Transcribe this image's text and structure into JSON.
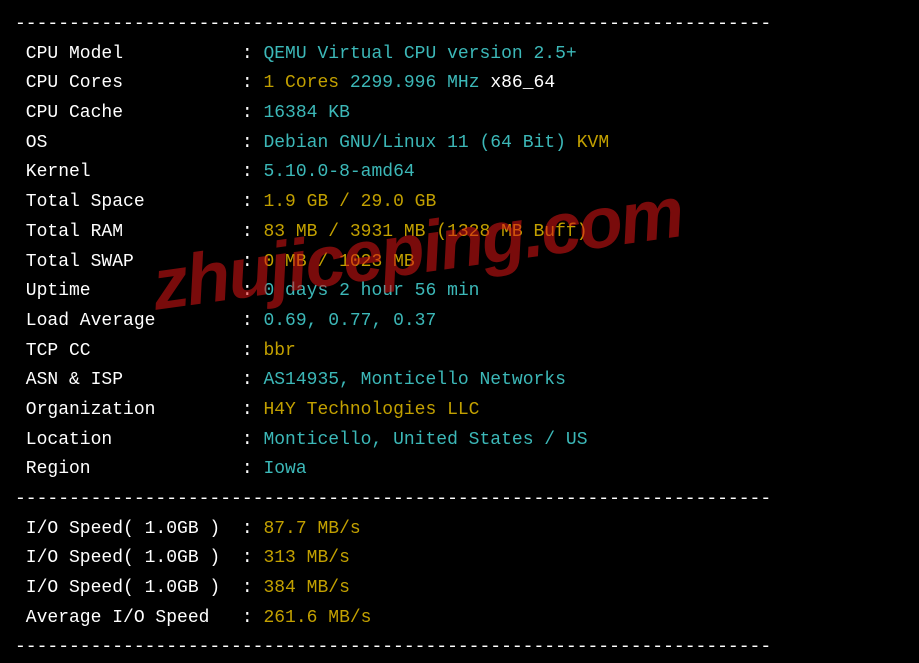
{
  "divider": "----------------------------------------------------------------------",
  "watermark": "zhujiceping.com",
  "rows": [
    {
      "label": "CPU Model",
      "parts": [
        {
          "text": "QEMU Virtual CPU version 2.5+",
          "cls": "cyan"
        }
      ]
    },
    {
      "label": "CPU Cores",
      "parts": [
        {
          "text": "1 Cores ",
          "cls": "yellow"
        },
        {
          "text": "2299.996 MHz ",
          "cls": "cyan"
        },
        {
          "text": "x86_64",
          "cls": "white"
        }
      ]
    },
    {
      "label": "CPU Cache",
      "parts": [
        {
          "text": "16384 KB",
          "cls": "cyan"
        }
      ]
    },
    {
      "label": "OS",
      "parts": [
        {
          "text": "Debian GNU/Linux 11 (64 Bit) ",
          "cls": "cyan"
        },
        {
          "text": "KVM",
          "cls": "yellow"
        }
      ]
    },
    {
      "label": "Kernel",
      "parts": [
        {
          "text": "5.10.0-8-amd64",
          "cls": "cyan"
        }
      ]
    },
    {
      "label": "Total Space",
      "parts": [
        {
          "text": "1.9 GB / 29.0 GB",
          "cls": "yellow"
        }
      ]
    },
    {
      "label": "Total RAM",
      "parts": [
        {
          "text": "83 MB / 3931 MB (1328 MB Buff)",
          "cls": "yellow"
        }
      ]
    },
    {
      "label": "Total SWAP",
      "parts": [
        {
          "text": "0 MB / 1023 MB",
          "cls": "yellow"
        }
      ]
    },
    {
      "label": "Uptime",
      "parts": [
        {
          "text": "0 days 2 hour 56 min",
          "cls": "cyan"
        }
      ]
    },
    {
      "label": "Load Average",
      "parts": [
        {
          "text": "0.69, 0.77, 0.37",
          "cls": "cyan"
        }
      ]
    },
    {
      "label": "TCP CC",
      "parts": [
        {
          "text": "bbr",
          "cls": "yellow"
        }
      ]
    },
    {
      "label": "ASN & ISP",
      "parts": [
        {
          "text": "AS14935, Monticello Networks",
          "cls": "cyan"
        }
      ]
    },
    {
      "label": "Organization",
      "parts": [
        {
          "text": "H4Y Technologies LLC",
          "cls": "yellow"
        }
      ]
    },
    {
      "label": "Location",
      "parts": [
        {
          "text": "Monticello, United States / US",
          "cls": "cyan"
        }
      ]
    },
    {
      "label": "Region",
      "parts": [
        {
          "text": "Iowa",
          "cls": "cyan"
        }
      ]
    }
  ],
  "io_rows": [
    {
      "label": "I/O Speed( 1.0GB )",
      "parts": [
        {
          "text": "87.7 MB/s",
          "cls": "yellow"
        }
      ]
    },
    {
      "label": "I/O Speed( 1.0GB )",
      "parts": [
        {
          "text": "313 MB/s",
          "cls": "yellow"
        }
      ]
    },
    {
      "label": "I/O Speed( 1.0GB )",
      "parts": [
        {
          "text": "384 MB/s",
          "cls": "yellow"
        }
      ]
    },
    {
      "label": "Average I/O Speed",
      "parts": [
        {
          "text": "261.6 MB/s",
          "cls": "yellow"
        }
      ]
    }
  ]
}
